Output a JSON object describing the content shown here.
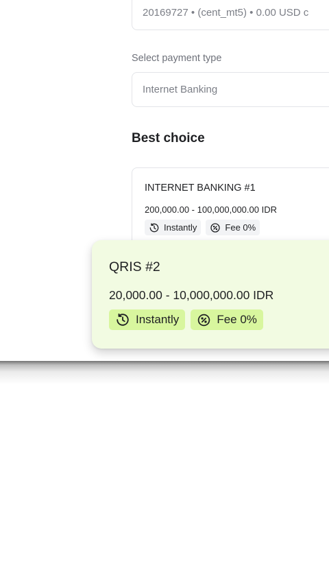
{
  "account": {
    "summary": "20169727 • (cent_mt5) • 0.00 USD c"
  },
  "payment": {
    "label": "Select payment type",
    "value": "Internet Banking"
  },
  "best_choice": {
    "title": "Best choice"
  },
  "methods": [
    {
      "name": "INTERNET BANKING #1",
      "range": "200,000.00 - 100,000,000.00 IDR",
      "speed": "Instantly",
      "fee": "Fee 0%"
    },
    {
      "name": "QRIS #2",
      "range": "20,000.00 - 10,000,000.00 IDR",
      "speed": "Instantly",
      "fee": "Fee 0%"
    }
  ],
  "icons": {
    "speed": "clock-history-icon",
    "fee": "percent-circle-icon"
  },
  "colors": {
    "highlight_card": "#f2fbe2",
    "highlight_badge": "#d8f69e",
    "badge": "#f2f3f5"
  }
}
